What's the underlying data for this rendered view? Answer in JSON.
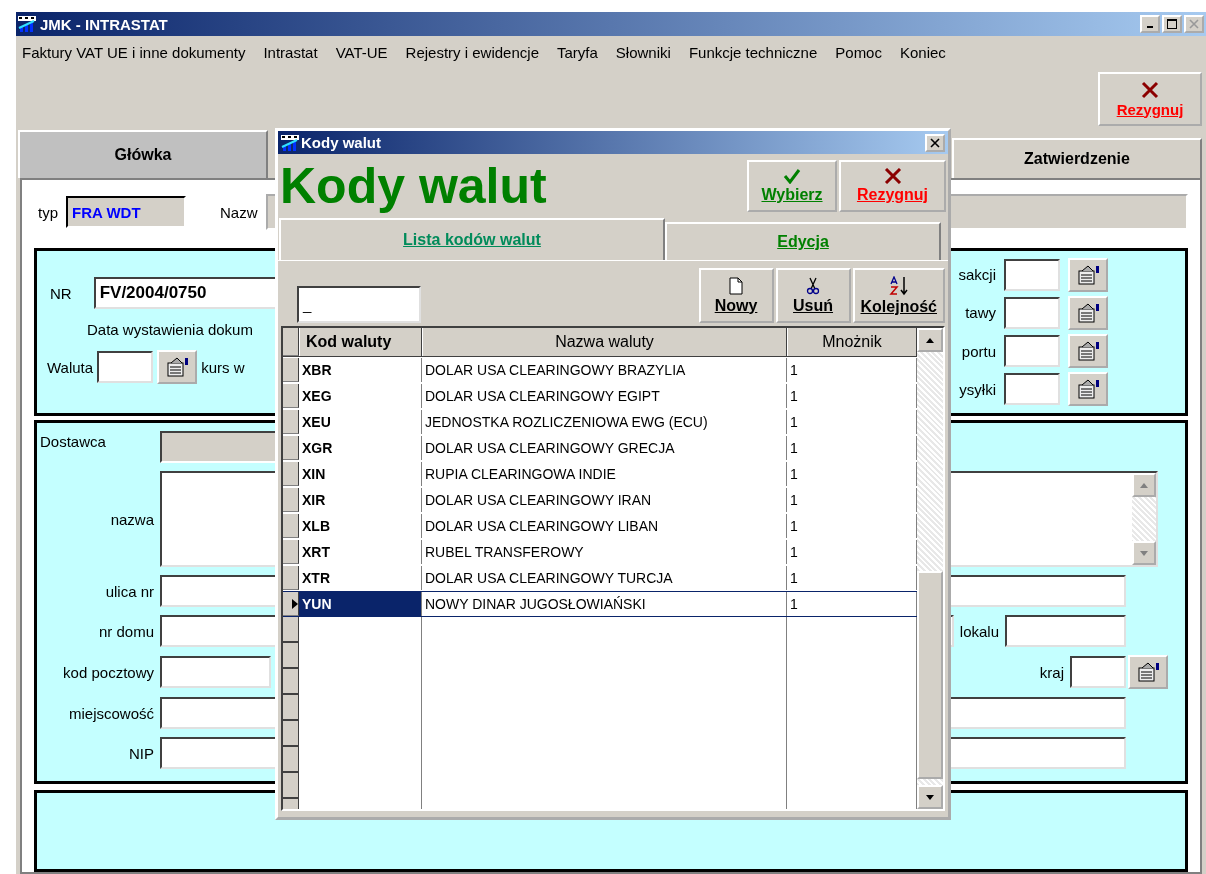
{
  "window": {
    "title": "JMK - INTRASTAT"
  },
  "menu": [
    "Faktury VAT UE i inne dokumenty",
    "Intrastat",
    "VAT-UE",
    "Rejestry i ewidencje",
    "Taryfa",
    "Słowniki",
    "Funkcje techniczne",
    "Pomoc",
    "Koniec"
  ],
  "toolbar": {
    "cancel": "Rezygnuj"
  },
  "tabs": [
    {
      "label": "Główka",
      "selected": true
    },
    {
      "label": "Zatwierdzenie",
      "selected": false
    }
  ],
  "header": {
    "type_label": "typ",
    "type_value": "FRA WDT",
    "name_label": "Nazw"
  },
  "document": {
    "nr_label": "NR",
    "nr_value": "FV/2004/0750",
    "date_label": "Data wystawienia dokum",
    "currency_label": "Waluta",
    "rate_label": "kurs w",
    "right_fields": [
      {
        "label": "sakcji"
      },
      {
        "label": "tawy"
      },
      {
        "label": "portu"
      },
      {
        "label": "ysyłki"
      }
    ]
  },
  "supplier": {
    "title": "Dostawca",
    "rows": [
      {
        "label": "nazwa",
        "kind": "textarea"
      },
      {
        "label": "ulica nr",
        "kind": "text"
      },
      {
        "label": "nr domu",
        "kind": "text",
        "right_label": "lokalu"
      },
      {
        "label": "kod pocztowy",
        "kind": "short",
        "right_label": "kraj"
      },
      {
        "label": "miejscowość",
        "kind": "text"
      },
      {
        "label": "NIP",
        "kind": "text"
      }
    ]
  },
  "dialog": {
    "title": "Kody walut",
    "heading": "Kody walut",
    "buttons": [
      {
        "label": "Wybierz",
        "kind": "ok"
      },
      {
        "label": "Rezygnuj",
        "kind": "cancel"
      }
    ],
    "tabs": [
      {
        "label": "Lista kodów walut",
        "selected": true
      },
      {
        "label": "Edycja",
        "selected": false
      }
    ],
    "search": {
      "value": "_"
    },
    "actions": [
      {
        "label": "Nowy",
        "kind": "new"
      },
      {
        "label": "Usuń",
        "kind": "delete"
      },
      {
        "label": "Kolejność",
        "kind": "sort"
      }
    ],
    "table": {
      "columns": [
        "Kod waluty",
        "Nazwa waluty",
        "Mnożnik"
      ],
      "rows": [
        {
          "code": "XBR",
          "name": "DOLAR USA CLEARINGOWY BRAZYLIA",
          "multiplier": "1",
          "selected": false
        },
        {
          "code": "XEG",
          "name": "DOLAR USA CLEARINGOWY EGIPT",
          "multiplier": "1",
          "selected": false
        },
        {
          "code": "XEU",
          "name": "JEDNOSTKA ROZLICZENIOWA EWG (ECU)",
          "multiplier": "1",
          "selected": false
        },
        {
          "code": "XGR",
          "name": "DOLAR USA CLEARINGOWY GRECJA",
          "multiplier": "1",
          "selected": false
        },
        {
          "code": "XIN",
          "name": "RUPIA CLEARINGOWA INDIE",
          "multiplier": "1",
          "selected": false
        },
        {
          "code": "XIR",
          "name": "DOLAR USA CLEARINGOWY IRAN",
          "multiplier": "1",
          "selected": false
        },
        {
          "code": "XLB",
          "name": "DOLAR USA CLEARINGOWY LIBAN",
          "multiplier": "1",
          "selected": false
        },
        {
          "code": "XRT",
          "name": "RUBEL TRANSFEROWY",
          "multiplier": "1",
          "selected": false
        },
        {
          "code": "XTR",
          "name": "DOLAR USA CLEARINGOWY TURCJA",
          "multiplier": "1",
          "selected": false
        },
        {
          "code": "YUN",
          "name": "NOWY DINAR JUGOSŁOWIAŃSKI",
          "multiplier": "1",
          "selected": true
        }
      ]
    }
  }
}
